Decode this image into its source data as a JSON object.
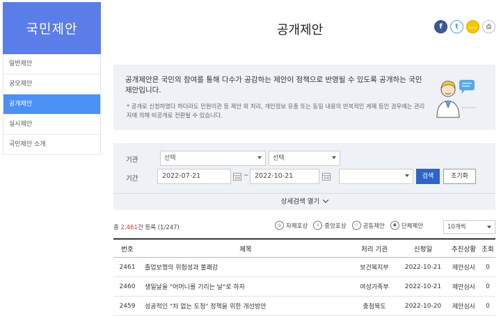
{
  "sidebar": {
    "brand": "국민제안",
    "items": [
      {
        "label": "일반제안",
        "active": false
      },
      {
        "label": "공모제안",
        "active": false
      },
      {
        "label": "공개제안",
        "active": true
      },
      {
        "label": "실시제안",
        "active": false
      },
      {
        "label": "국민제안 소개",
        "active": false
      }
    ]
  },
  "header": {
    "title": "공개제안",
    "social": {
      "facebook": "f",
      "twitter": "t",
      "kakao": "…",
      "print": "⎙"
    }
  },
  "info": {
    "main": "공개제안은 국민의 참여를 통해 다수가 공감하는 제안이 정책으로 반영될 수 있도록 공개하는 국민제안입니다.",
    "note": "* 공개로 신청하였다 하더라도 민원이관 등 제안 외 처리, 개인정보 유출 또는 동일 내용의 반복적인 게재 등인 경우에는 관리자에 의해 비공개로 전환될 수 있습니다."
  },
  "search": {
    "org_label": "기관",
    "period_label": "기간",
    "org_select_1": "선택",
    "org_select_2": "선택",
    "date_from": "2022-07-21",
    "date_sep": "~",
    "date_to": "2022-10-21",
    "extra_select": "",
    "search_button": "검색",
    "reset_button": "초기화",
    "advanced_label": "상세검색 열기"
  },
  "results": {
    "prefix": "총 ",
    "total": "2,461",
    "suffix": "건 등록 (1/247)",
    "filters": [
      "자체포상",
      "중앙포상",
      "공동제안",
      "단체제안"
    ],
    "per_page": "10개씩"
  },
  "table": {
    "headers": {
      "no": "번호",
      "title": "제목",
      "org": "처리 기관",
      "date": "신청일",
      "status": "추진상황",
      "views": "조회"
    },
    "rows": [
      {
        "no": "2461",
        "title": "졸업보행의 위험성과 불쾌감",
        "org": "보건복지부",
        "date": "2022-10-21",
        "status": "제안심사",
        "views": "0"
      },
      {
        "no": "2460",
        "title": "생일날을 \"어머니를 기리는 날\"로 하자",
        "org": "여성가족부",
        "date": "2022-10-21",
        "status": "제안심사",
        "views": "0"
      },
      {
        "no": "2459",
        "title": "성공적인 \"차 없는 도청\" 정책을 위한 개선방안",
        "org": "충청북도",
        "date": "2022-10-20",
        "status": "제안심사",
        "views": "0"
      }
    ]
  },
  "colors": {
    "brand": "#5b7de8",
    "active": "#4a90f5",
    "search_button": "#2e64c8",
    "count_highlight": "#dd3333"
  }
}
